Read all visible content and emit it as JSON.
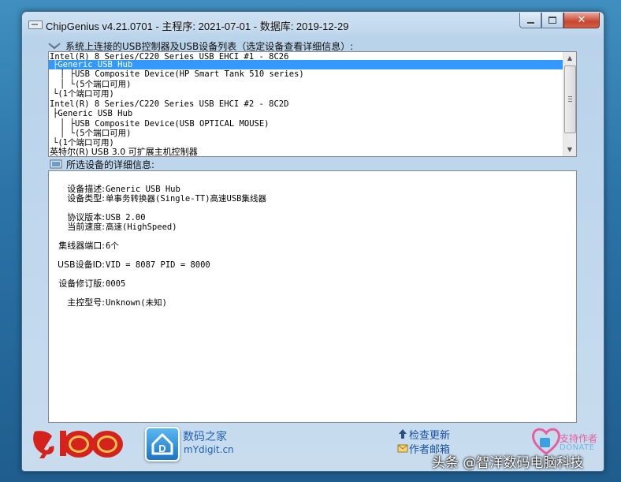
{
  "window": {
    "title": "ChipGenius v4.21.0701 - 主程序: 2021-07-01 - 数据库: 2019-12-29",
    "close_glyph": "✕"
  },
  "device_list": {
    "label": "系统上连接的USB控制器及USB设备列表（选定设备查看详细信息）:",
    "items": [
      {
        "text": "Intel(R) 8 Series/C220 Series USB EHCI #1 - 8C26",
        "selected": false
      },
      {
        "text": "├Generic USB Hub",
        "selected": true
      },
      {
        "text": "│  ├USB Composite Device(HP Smart Tank 510 series)",
        "selected": false
      },
      {
        "text": "│  └(5个端口可用)",
        "selected": false
      },
      {
        "text": "└(1个端口可用)",
        "selected": false
      },
      {
        "text": "Intel(R) 8 Series/C220 Series USB EHCI #2 - 8C2D",
        "selected": false
      },
      {
        "text": "├Generic USB Hub",
        "selected": false
      },
      {
        "text": "│  ├USB Composite Device(USB OPTICAL MOUSE)",
        "selected": false
      },
      {
        "text": "│  └(5个端口可用)",
        "selected": false
      },
      {
        "text": "└(1个端口可用)",
        "selected": false
      },
      {
        "text": "英特尔(R) USB 3.0 可扩展主机控制器",
        "selected": false
      }
    ]
  },
  "details": {
    "label": "所选设备的详细信息:",
    "fields": [
      {
        "key": "设备描述:",
        "value": "Generic USB Hub"
      },
      {
        "key": "设备类型:",
        "value": "单事务转换器(Single-TT)高速USB集线器"
      },
      {
        "key": "协议版本:",
        "value": "USB 2.00"
      },
      {
        "key": "当前速度:",
        "value": "高速(HighSpeed)"
      },
      {
        "key": "集线器端口:",
        "value": "6个"
      },
      {
        "key": "USB设备ID:",
        "value": "VID = 8087 PID = 8000"
      },
      {
        "key": "设备修订版:",
        "value": "0005"
      },
      {
        "key": "主控型号:",
        "value": "Unknown(未知)"
      }
    ]
  },
  "footer": {
    "brand_name": "数码之家",
    "brand_url": "mYdigit.cn",
    "check_update": "检查更新",
    "author_email": "作者邮箱",
    "support_author": "支持作者",
    "donate": "DONATE",
    "party_badge_text": "100"
  },
  "watermark": "头条 @智洋数码电脑科技",
  "colors": {
    "selection": "#3399ff",
    "link": "#1b52a5",
    "brand": "#1f60b8",
    "donate_pink": "#e65ea0",
    "party_red": "#d4231c"
  }
}
